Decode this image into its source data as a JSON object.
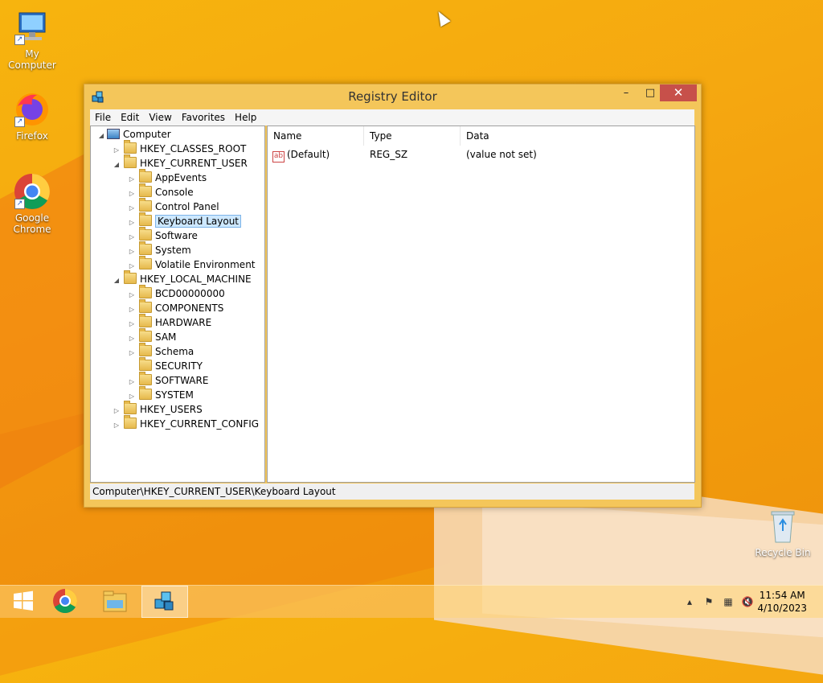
{
  "desktop": {
    "icons": [
      {
        "label": "My Computer"
      },
      {
        "label": "Firefox"
      },
      {
        "label": "Google Chrome"
      },
      {
        "label": "Recycle Bin"
      }
    ]
  },
  "window": {
    "title": "Registry Editor",
    "controls": {
      "minimize": "–",
      "maximize": "□",
      "close": "✕"
    },
    "menu": [
      "File",
      "Edit",
      "View",
      "Favorites",
      "Help"
    ],
    "tree": [
      {
        "label": "Computer",
        "expander": "◢"
      },
      {
        "label": "HKEY_CLASSES_ROOT",
        "expander": "▷"
      },
      {
        "label": "HKEY_CURRENT_USER",
        "expander": "◢"
      },
      {
        "label": "AppEvents",
        "expander": "▷"
      },
      {
        "label": "Console",
        "expander": "▷"
      },
      {
        "label": "Control Panel",
        "expander": "▷"
      },
      {
        "label": "Keyboard Layout",
        "expander": "▷",
        "selected": true
      },
      {
        "label": "Software",
        "expander": "▷"
      },
      {
        "label": "System",
        "expander": "▷"
      },
      {
        "label": "Volatile Environment",
        "expander": "▷"
      },
      {
        "label": "HKEY_LOCAL_MACHINE",
        "expander": "◢"
      },
      {
        "label": "BCD00000000",
        "expander": "▷"
      },
      {
        "label": "COMPONENTS",
        "expander": "▷"
      },
      {
        "label": "HARDWARE",
        "expander": "▷"
      },
      {
        "label": "SAM",
        "expander": "▷"
      },
      {
        "label": "Schema",
        "expander": "▷"
      },
      {
        "label": "SECURITY",
        "expander": ""
      },
      {
        "label": "SOFTWARE",
        "expander": "▷"
      },
      {
        "label": "SYSTEM",
        "expander": "▷"
      },
      {
        "label": "HKEY_USERS",
        "expander": "▷"
      },
      {
        "label": "HKEY_CURRENT_CONFIG",
        "expander": "▷"
      }
    ],
    "list": {
      "columns": [
        "Name",
        "Type",
        "Data"
      ],
      "rows": [
        {
          "name": "(Default)",
          "type": "REG_SZ",
          "data": "(value not set)",
          "icon": "ab"
        }
      ]
    },
    "status": "Computer\\HKEY_CURRENT_USER\\Keyboard Layout"
  },
  "taskbar": {
    "apps": [
      "start-icon",
      "chrome-icon",
      "file-explorer-icon",
      "registry-editor-icon"
    ],
    "clock": {
      "time": "11:54 AM",
      "date": "4/10/2023"
    }
  },
  "colors": {
    "accent_close": "#c7504a",
    "window_frame": "#f4c65a",
    "selection": "#cde8ff"
  }
}
